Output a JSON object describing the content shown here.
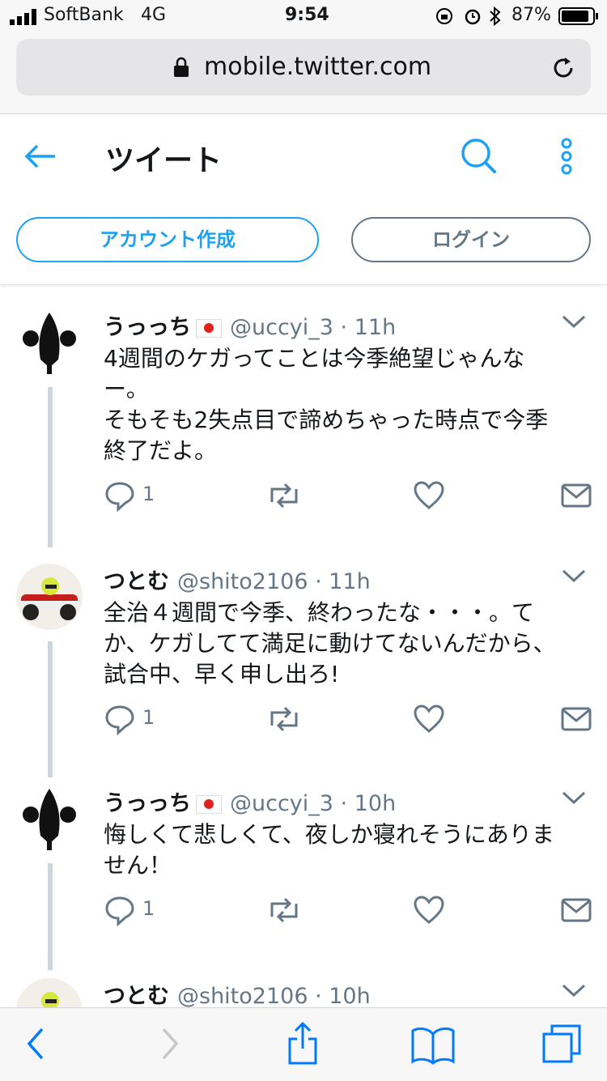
{
  "status_bar": {
    "carrier": "SoftBank",
    "network": "4G",
    "time": "9:54",
    "battery": "87%"
  },
  "browser": {
    "url": "mobile.twitter.com"
  },
  "header": {
    "title": "ツイート",
    "signup_label": "アカウント作成",
    "login_label": "ログイン"
  },
  "tweets": [
    {
      "name": "うっっち",
      "handle": "@uccyi_3",
      "time": "11h",
      "text": "4週間のケガってことは今季絶望じゃんな\nー。\nそもそも2失点目で諦めちゃった時点で今季\n終了だよ。",
      "reply_count": "1"
    },
    {
      "name": "つとむ",
      "handle": "@shito2106",
      "time": "11h",
      "text": "全治４週間で今季、終わったな・・・。て\nか、ケガしてて満足に動けてないんだから、\n試合中、早く申し出ろ!",
      "reply_count": "1"
    },
    {
      "name": "うっっち",
      "handle": "@uccyi_3",
      "time": "10h",
      "text": "悔しくて悲しくて、夜しか寝れそうにありま\nせん！",
      "reply_count": "1"
    },
    {
      "name": "つとむ",
      "handle": "@shito2106",
      "time": "10h"
    }
  ],
  "colors": {
    "twitter_blue": "#1da1f2",
    "meta_gray": "#657786",
    "ios_blue": "#007aff"
  }
}
